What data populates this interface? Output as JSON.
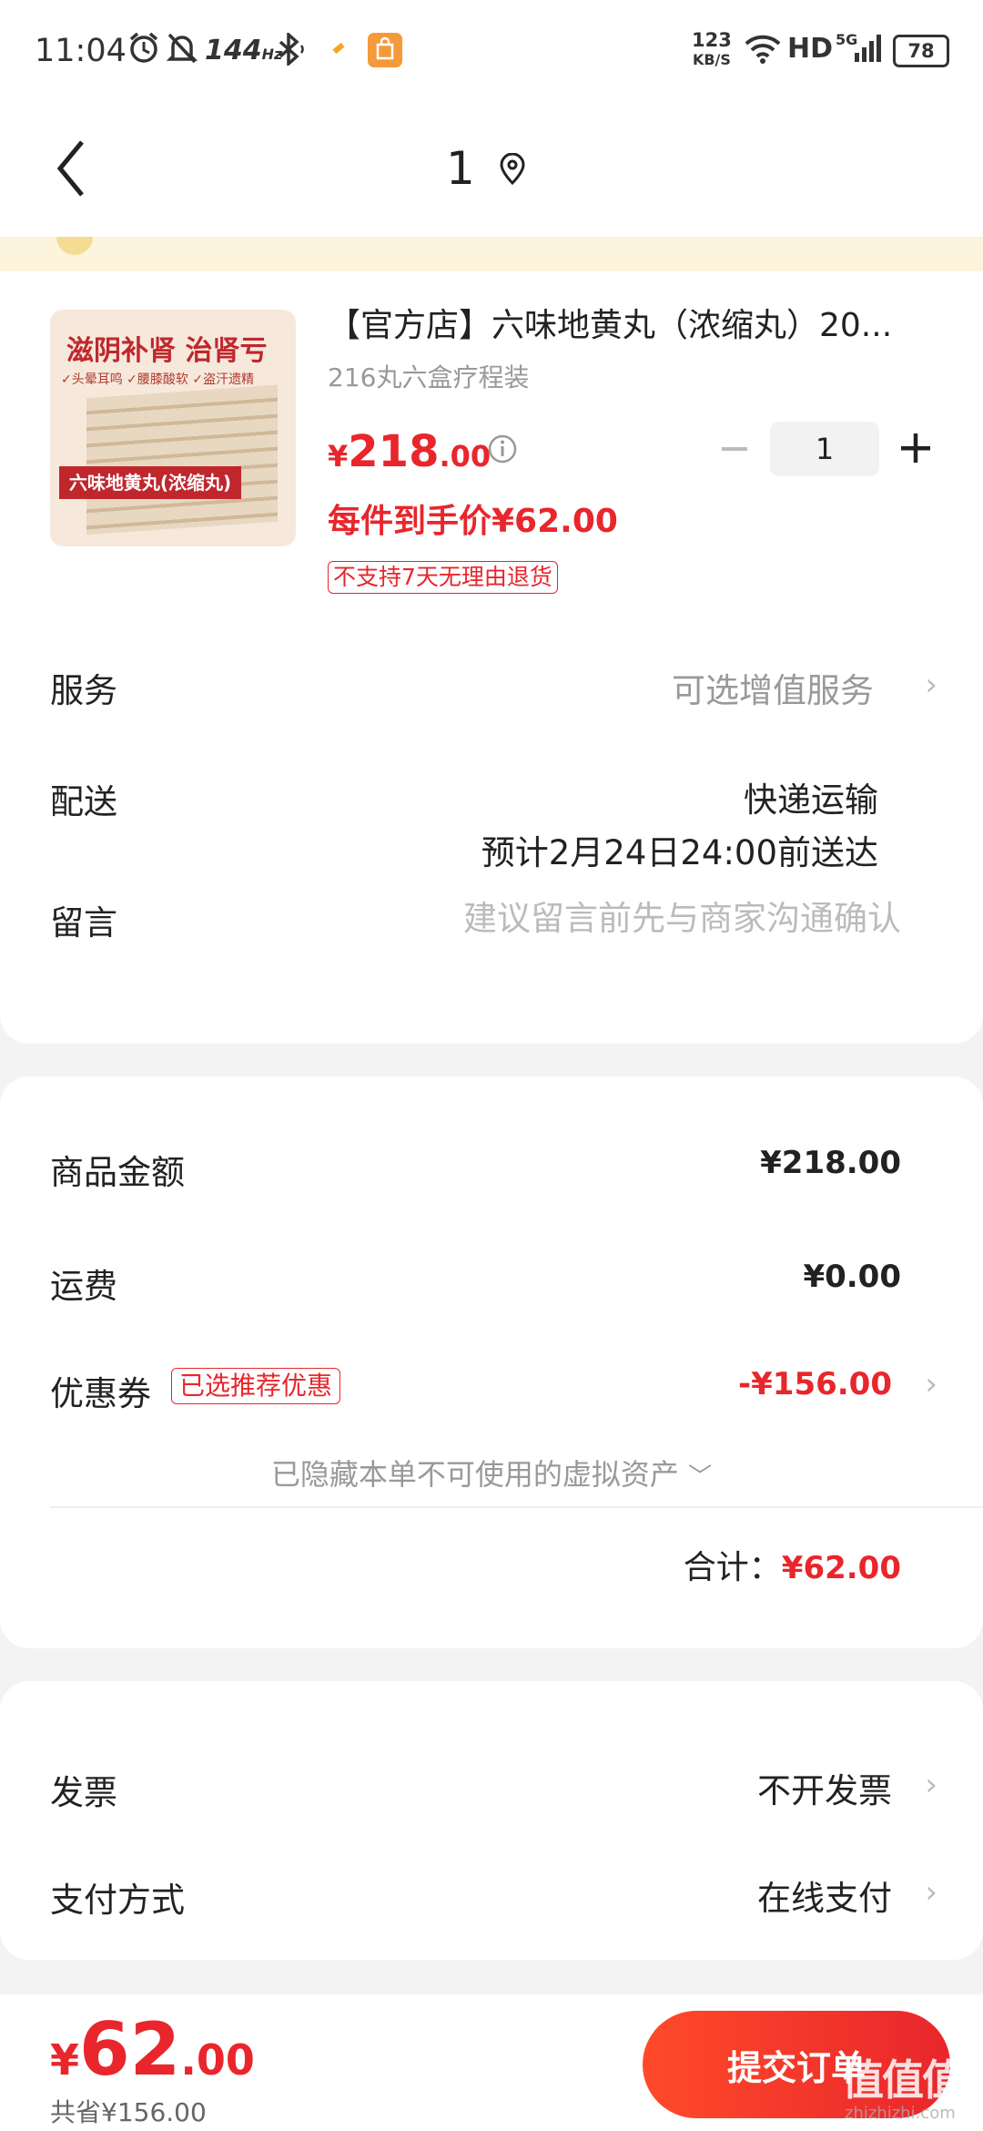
{
  "status_bar": {
    "time": "11:04",
    "refresh_rate": "144",
    "refresh_unit": "Hz",
    "net_speed_value": "123",
    "net_speed_unit": "KB/S",
    "hd": "HD",
    "network": "5G",
    "battery": "78"
  },
  "header": {
    "title": "1"
  },
  "product": {
    "title": "【官方店】六味地黄丸（浓缩丸）20...",
    "spec": "216丸六盒疗程装",
    "price_symbol": "¥",
    "price_int": "218",
    "price_dec": ".00",
    "quantity": "1",
    "unit_price_label": "每件到手价¥62.00",
    "return_badge": "不支持7天无理由退货",
    "image_text": {
      "headline1": "滋阴补肾",
      "headline2": "治肾亏",
      "tag1": "头晕耳鸣",
      "tag2": "腰膝酸软",
      "tag3": "盗汗遗精",
      "box_label": "六味地黄丸(浓缩丸)"
    }
  },
  "order_rows": {
    "service_label": "服务",
    "service_value": "可选增值服务",
    "delivery_label": "配送",
    "delivery_method": "快递运输",
    "delivery_eta": "预计2月24日24:00前送达",
    "note_label": "留言",
    "note_placeholder": "建议留言前先与商家沟通确认"
  },
  "summary": {
    "goods_label": "商品金额",
    "goods_value": "¥218.00",
    "shipping_label": "运费",
    "shipping_value": "¥0.00",
    "coupon_label": "优惠券",
    "coupon_badge": "已选推荐优惠",
    "coupon_value": "-¥156.00",
    "hidden_assets": "已隐藏本单不可使用的虚拟资产",
    "total_label": "合计：",
    "total_value": "¥62.00"
  },
  "payment": {
    "invoice_label": "发票",
    "invoice_value": "不开发票",
    "pay_label": "支付方式",
    "pay_value": "在线支付"
  },
  "bottom_bar": {
    "price_symbol": "¥",
    "price_int": "62",
    "price_dec": ".00",
    "saved": "共省¥156.00",
    "submit_label": "提交订单"
  },
  "watermark": {
    "text": "值值值",
    "url": "zhizhizhi.com"
  },
  "colors": {
    "accent_red": "#e8262c",
    "banner_yellow": "#fdf4dd"
  }
}
